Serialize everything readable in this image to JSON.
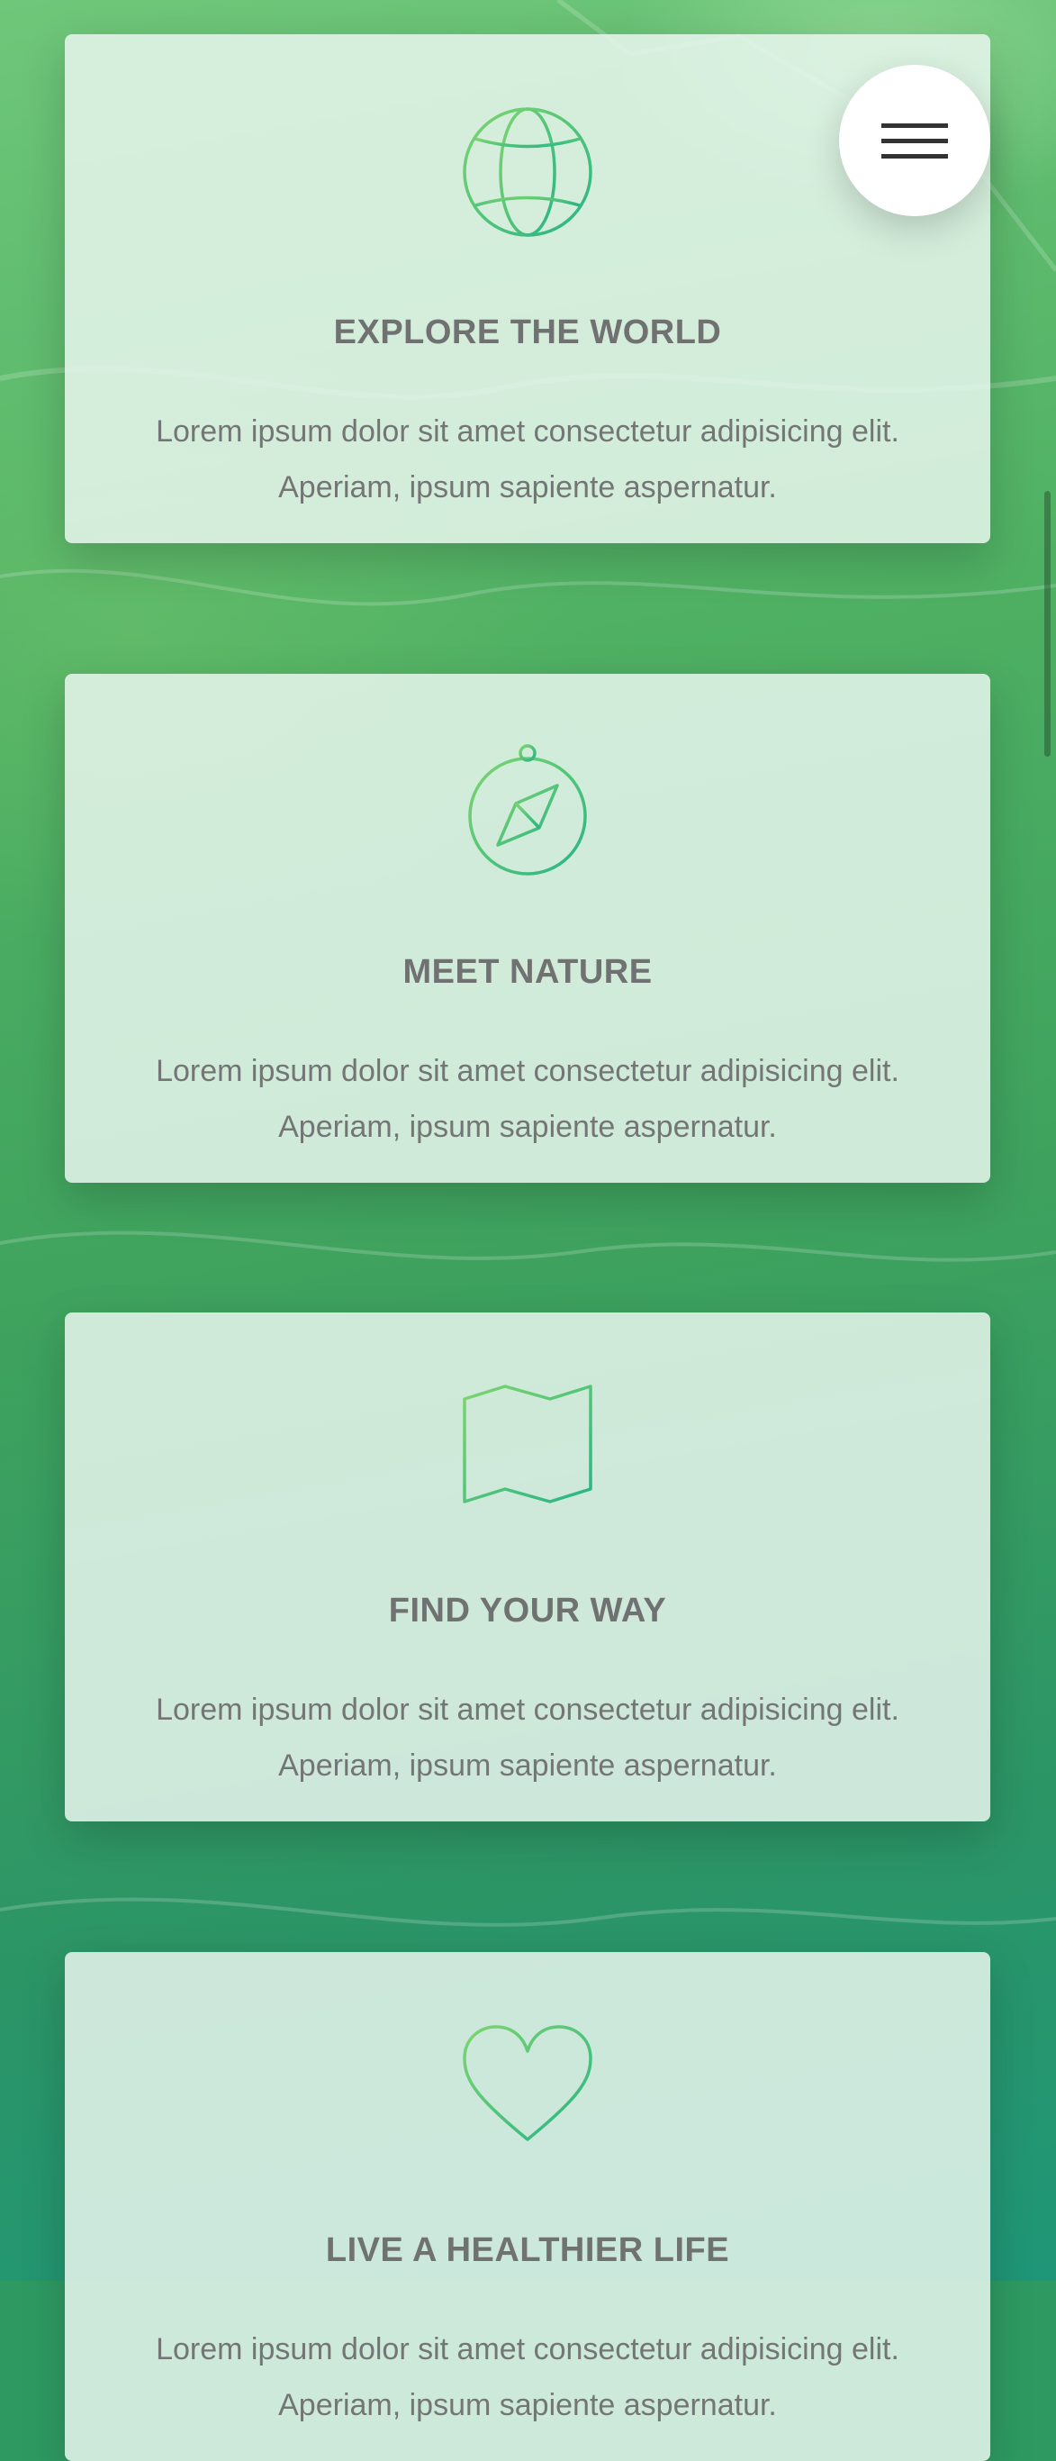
{
  "menu": {
    "icon": "hamburger-menu-icon"
  },
  "colors": {
    "icon_gradient_start": "#7ed56f",
    "icon_gradient_end": "#28b485",
    "card_title": "#707272",
    "card_text": "#747676"
  },
  "features": [
    {
      "icon": "globe-icon",
      "title": "EXPLORE THE WORLD",
      "text": "Lorem ipsum dolor sit amet consectetur adipisicing elit. Aperiam, ipsum sapiente aspernatur."
    },
    {
      "icon": "compass-icon",
      "title": "MEET NATURE",
      "text": "Lorem ipsum dolor sit amet consectetur adipisicing elit. Aperiam, ipsum sapiente aspernatur."
    },
    {
      "icon": "map-icon",
      "title": "FIND YOUR WAY",
      "text": "Lorem ipsum dolor sit amet consectetur adipisicing elit. Aperiam, ipsum sapiente aspernatur."
    },
    {
      "icon": "heart-icon",
      "title": "LIVE A HEALTHIER LIFE",
      "text": "Lorem ipsum dolor sit amet consectetur adipisicing elit. Aperiam, ipsum sapiente aspernatur."
    }
  ]
}
